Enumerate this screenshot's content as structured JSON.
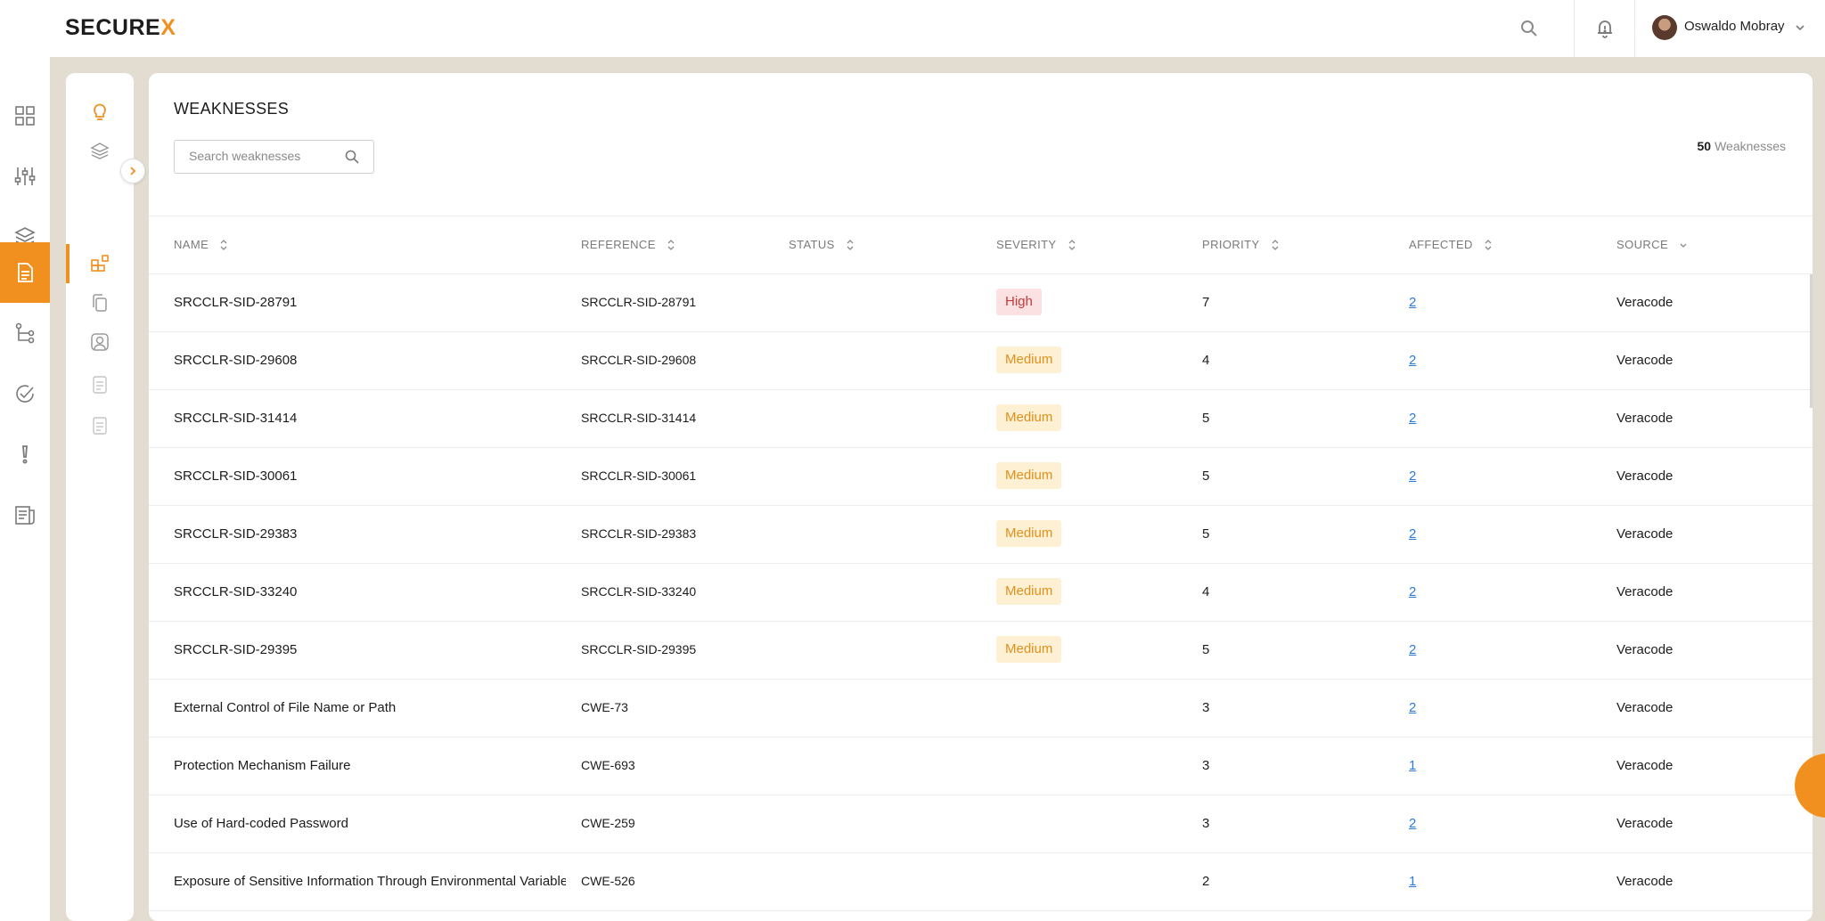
{
  "app": {
    "logo_text": "SECURE",
    "logo_accent": "X",
    "accent_color": "#f1901f"
  },
  "header": {
    "user_name": "Oswaldo Mobray",
    "icons": [
      "search-icon",
      "bell-alert-icon",
      "chevron-down-icon"
    ]
  },
  "rail": {
    "items": [
      {
        "icon": "dashboard-grid-icon"
      },
      {
        "icon": "sliders-icon"
      },
      {
        "icon": "layers-icon"
      },
      {
        "icon": "document-icon",
        "active": true
      },
      {
        "icon": "branch-tree-icon"
      },
      {
        "icon": "check-circle-icon"
      },
      {
        "icon": "alert-exclamation-icon"
      },
      {
        "icon": "report-icon"
      }
    ]
  },
  "subnav": {
    "items": [
      {
        "icon": "lightbulb-icon"
      },
      {
        "icon": "stack-layers-icon"
      },
      {
        "icon": "blocks-icon",
        "active": true
      },
      {
        "icon": "copy-icon"
      },
      {
        "icon": "user-portrait-icon"
      },
      {
        "icon": "file-text-icon"
      },
      {
        "icon": "file-lines-icon"
      }
    ]
  },
  "page": {
    "title": "WEAKNESSES",
    "search_placeholder": "Search weaknesses",
    "count_number": "50",
    "count_label": "Weaknesses"
  },
  "table": {
    "columns": [
      {
        "key": "name",
        "label": "NAME",
        "sort": "both"
      },
      {
        "key": "reference",
        "label": "REFERENCE",
        "sort": "both"
      },
      {
        "key": "status",
        "label": "STATUS",
        "sort": "both"
      },
      {
        "key": "severity",
        "label": "SEVERITY",
        "sort": "both"
      },
      {
        "key": "priority",
        "label": "PRIORITY",
        "sort": "both"
      },
      {
        "key": "affected",
        "label": "AFFECTED",
        "sort": "both"
      },
      {
        "key": "source",
        "label": "SOURCE",
        "sort": "down"
      }
    ],
    "rows": [
      {
        "name": "SRCCLR-SID-28791",
        "reference": "SRCCLR-SID-28791",
        "status": "",
        "severity": "High",
        "priority": "7",
        "affected": "2",
        "source": "Veracode"
      },
      {
        "name": "SRCCLR-SID-29608",
        "reference": "SRCCLR-SID-29608",
        "status": "",
        "severity": "Medium",
        "priority": "4",
        "affected": "2",
        "source": "Veracode"
      },
      {
        "name": "SRCCLR-SID-31414",
        "reference": "SRCCLR-SID-31414",
        "status": "",
        "severity": "Medium",
        "priority": "5",
        "affected": "2",
        "source": "Veracode"
      },
      {
        "name": "SRCCLR-SID-30061",
        "reference": "SRCCLR-SID-30061",
        "status": "",
        "severity": "Medium",
        "priority": "5",
        "affected": "2",
        "source": "Veracode"
      },
      {
        "name": "SRCCLR-SID-29383",
        "reference": "SRCCLR-SID-29383",
        "status": "",
        "severity": "Medium",
        "priority": "5",
        "affected": "2",
        "source": "Veracode"
      },
      {
        "name": "SRCCLR-SID-33240",
        "reference": "SRCCLR-SID-33240",
        "status": "",
        "severity": "Medium",
        "priority": "4",
        "affected": "2",
        "source": "Veracode"
      },
      {
        "name": "SRCCLR-SID-29395",
        "reference": "SRCCLR-SID-29395",
        "status": "",
        "severity": "Medium",
        "priority": "5",
        "affected": "2",
        "source": "Veracode"
      },
      {
        "name": "External Control of File Name or Path",
        "reference": "CWE-73",
        "status": "",
        "severity": "",
        "priority": "3",
        "affected": "2",
        "source": "Veracode"
      },
      {
        "name": "Protection Mechanism Failure",
        "reference": "CWE-693",
        "status": "",
        "severity": "",
        "priority": "3",
        "affected": "1",
        "source": "Veracode"
      },
      {
        "name": "Use of Hard-coded Password",
        "reference": "CWE-259",
        "status": "",
        "severity": "",
        "priority": "3",
        "affected": "2",
        "source": "Veracode"
      },
      {
        "name": "Exposure of Sensitive Information Through Environmental Variables",
        "reference": "CWE-526",
        "status": "",
        "severity": "",
        "priority": "2",
        "affected": "1",
        "source": "Veracode"
      }
    ]
  }
}
